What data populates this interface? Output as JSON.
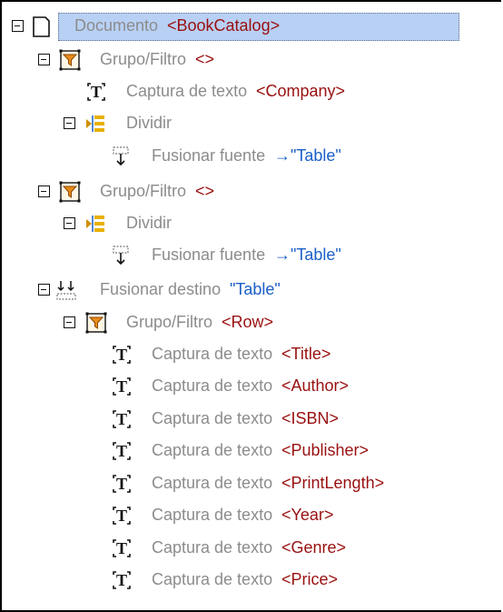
{
  "tree": {
    "nodes": [
      {
        "label": "Documento",
        "value": "<BookCatalog>",
        "icon": "document-icon",
        "color": "red",
        "expanded": true,
        "selected": true
      },
      {
        "label": "Grupo/Filtro",
        "value": "<>",
        "icon": "filter-icon",
        "color": "red",
        "expanded": true
      },
      {
        "label": "Captura de texto",
        "value": "<Company>",
        "icon": "text-capture-icon",
        "color": "red"
      },
      {
        "label": "Dividir",
        "value": "",
        "icon": "split-icon",
        "color": "red",
        "expanded": true
      },
      {
        "label": "Fusionar fuente",
        "value": "→\"Table\"",
        "icon": "merge-source-icon",
        "color": "blue"
      },
      {
        "label": "Grupo/Filtro",
        "value": "<>",
        "icon": "filter-icon",
        "color": "red",
        "expanded": true
      },
      {
        "label": "Dividir",
        "value": "",
        "icon": "split-icon",
        "color": "red",
        "expanded": true
      },
      {
        "label": "Fusionar fuente",
        "value": "→\"Table\"",
        "icon": "merge-source-icon",
        "color": "blue"
      },
      {
        "label": "Fusionar destino",
        "value": "\"Table\"",
        "icon": "merge-target-icon",
        "color": "blue",
        "expanded": true
      },
      {
        "label": "Grupo/Filtro",
        "value": "<Row>",
        "icon": "filter-icon",
        "color": "red",
        "expanded": true
      },
      {
        "label": "Captura de texto",
        "value": "<Title>",
        "icon": "text-capture-icon",
        "color": "red"
      },
      {
        "label": "Captura de texto",
        "value": "<Author>",
        "icon": "text-capture-icon",
        "color": "red"
      },
      {
        "label": "Captura de texto",
        "value": "<ISBN>",
        "icon": "text-capture-icon",
        "color": "red"
      },
      {
        "label": "Captura de texto",
        "value": "<Publisher>",
        "icon": "text-capture-icon",
        "color": "red"
      },
      {
        "label": "Captura de texto",
        "value": "<PrintLength>",
        "icon": "text-capture-icon",
        "color": "red"
      },
      {
        "label": "Captura de texto",
        "value": "<Year>",
        "icon": "text-capture-icon",
        "color": "red"
      },
      {
        "label": "Captura de texto",
        "value": "<Genre>",
        "icon": "text-capture-icon",
        "color": "red"
      },
      {
        "label": "Captura de texto",
        "value": "<Price>",
        "icon": "text-capture-icon",
        "color": "red"
      }
    ]
  },
  "colors": {
    "label": "#8c8c8c",
    "element_value": "#9a1010",
    "string_value": "#1a5fc8",
    "selection": "#b8d0f4"
  }
}
